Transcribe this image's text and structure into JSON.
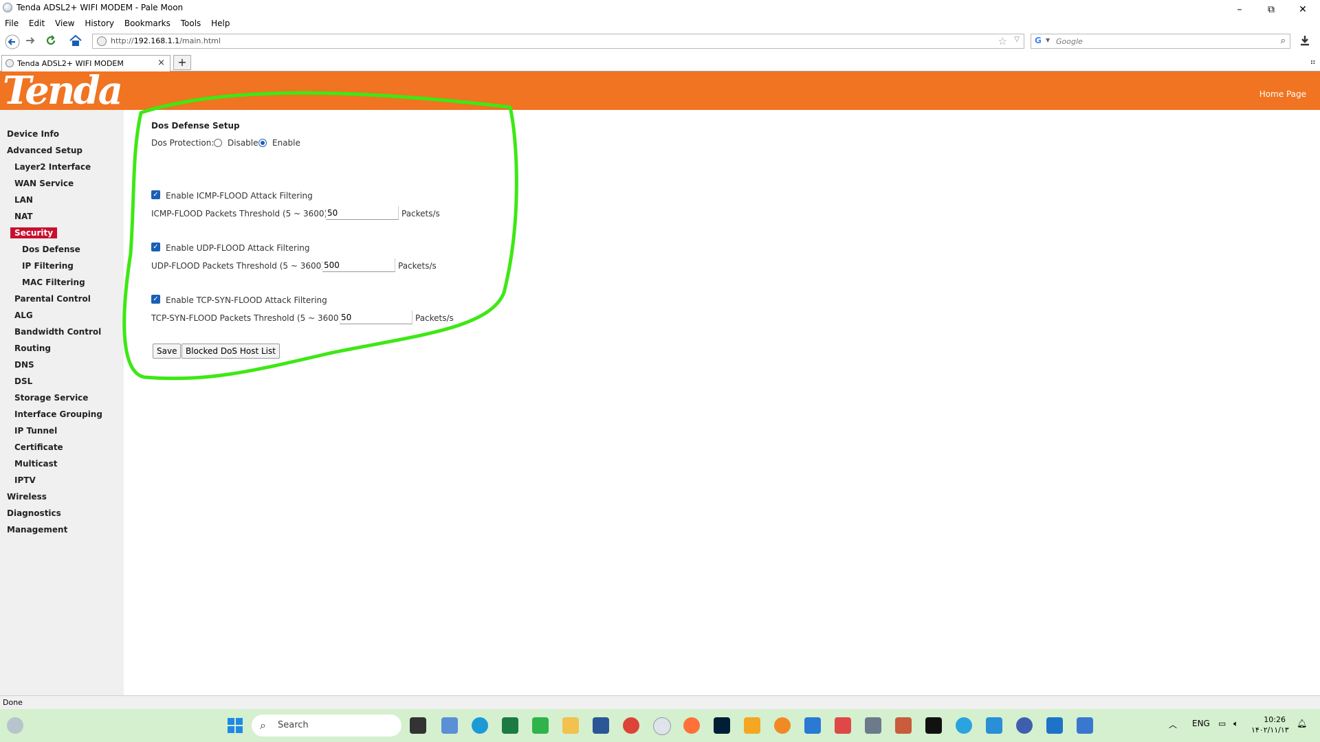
{
  "window": {
    "title": "Tenda ADSL2+ WIFI MODEM - Pale Moon",
    "minimize": "–",
    "restore": "⧉",
    "close": "✕"
  },
  "menu": [
    "File",
    "Edit",
    "View",
    "History",
    "Bookmarks",
    "Tools",
    "Help"
  ],
  "nav": {
    "url_prefix": "http://",
    "url_host": "192.168.1.1",
    "url_path": "/main.html",
    "search_placeholder": "Google"
  },
  "tab": {
    "label": "Tenda ADSL2+ WIFI MODEM",
    "close": "×",
    "new": "+"
  },
  "header": {
    "logo": "Tenda",
    "home_link": "Home Page"
  },
  "sidebar": {
    "items": [
      {
        "label": "Device Info",
        "level": 0
      },
      {
        "label": "Advanced Setup",
        "level": 0
      },
      {
        "label": "Layer2 Interface",
        "level": 1
      },
      {
        "label": "WAN Service",
        "level": 1
      },
      {
        "label": "LAN",
        "level": 1
      },
      {
        "label": "NAT",
        "level": 1
      },
      {
        "label": "Security",
        "level": 1,
        "active": true
      },
      {
        "label": "Dos Defense",
        "level": 2
      },
      {
        "label": "IP Filtering",
        "level": 2
      },
      {
        "label": "MAC Filtering",
        "level": 2
      },
      {
        "label": "Parental Control",
        "level": 1
      },
      {
        "label": "ALG",
        "level": 1
      },
      {
        "label": "Bandwidth Control",
        "level": 1
      },
      {
        "label": "Routing",
        "level": 1
      },
      {
        "label": "DNS",
        "level": 1
      },
      {
        "label": "DSL",
        "level": 1
      },
      {
        "label": "Storage Service",
        "level": 1
      },
      {
        "label": "Interface Grouping",
        "level": 1
      },
      {
        "label": "IP Tunnel",
        "level": 1
      },
      {
        "label": "Certificate",
        "level": 1
      },
      {
        "label": "Multicast",
        "level": 1
      },
      {
        "label": "IPTV",
        "level": 1
      },
      {
        "label": "Wireless",
        "level": 0
      },
      {
        "label": "Diagnostics",
        "level": 0
      },
      {
        "label": "Management",
        "level": 0
      }
    ]
  },
  "form": {
    "heading": "Dos Defense Setup",
    "protection_label": "Dos Protection:",
    "disable_label": "Disable",
    "enable_label": "Enable",
    "icmp": {
      "check_label": "Enable ICMP-FLOOD Attack Filtering",
      "threshold_label": "ICMP-FLOOD Packets Threshold (5 ~ 3600):",
      "value": "50",
      "unit": "Packets/s"
    },
    "udp": {
      "check_label": "Enable UDP-FLOOD Attack Filtering",
      "threshold_label": "UDP-FLOOD Packets Threshold (5 ~ 3600):",
      "value": "500",
      "unit": "Packets/s"
    },
    "tcp": {
      "check_label": "Enable TCP-SYN-FLOOD Attack Filtering",
      "threshold_label": "TCP-SYN-FLOOD Packets Threshold (5 ~ 3600):",
      "value": "50",
      "unit": "Packets/s"
    },
    "save_button": "Save",
    "blocked_button": "Blocked DoS Host List"
  },
  "status": "Done",
  "taskbar": {
    "search_label": "Search",
    "lang": "ENG",
    "time": "10:26",
    "date": "۱۴۰۲/۱۱/۱۳"
  },
  "colors": {
    "header": "#f07421",
    "active_nav": "#c8102e",
    "annotation": "#3ee814",
    "taskbar": "#d4f0cf"
  }
}
